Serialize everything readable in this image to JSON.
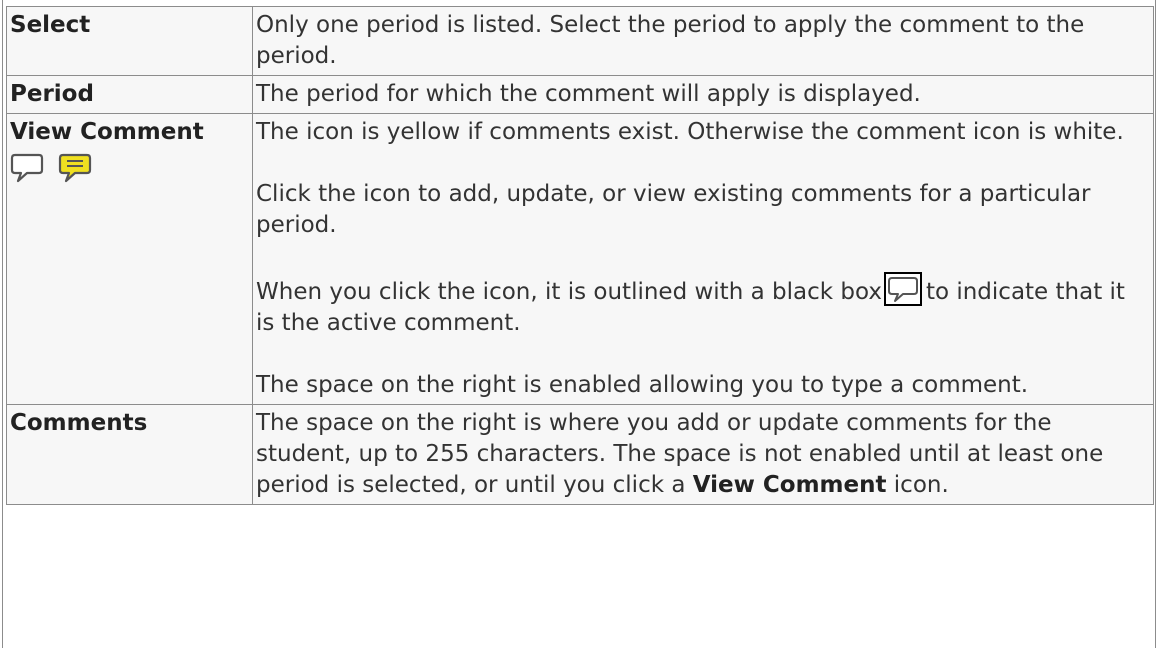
{
  "rows": [
    {
      "term": "Select",
      "desc": "Only one period is listed. Select the period to apply the comment to the period."
    },
    {
      "term": "Period",
      "desc": "The period for which the comment will apply is displayed."
    },
    {
      "term": "View Comment",
      "icons": [
        "comment-white-icon",
        "comment-yellow-icon"
      ],
      "p1": "The icon is yellow if comments exist. Otherwise the comment icon is white.",
      "p2": "Click the icon to add, update, or view existing comments for a particular period.",
      "p3_before": "When you click the icon, it is outlined with a black box",
      "p3_icon": "comment-outlined-icon",
      "p3_after": "to indicate that it is the active comment.",
      "p4": "The space on the right is enabled allowing you to type a comment."
    },
    {
      "term": "Comments",
      "desc_before": "The space on the right is where you add or update comments for the student, up to 255 characters. The space is not enabled until at least one period is selected, or until you click a",
      "desc_bold": "View Comment",
      "desc_after": "icon."
    }
  ],
  "colors": {
    "cell_background": "#f7f7f7",
    "border": "#8c8c8c",
    "text": "#333333",
    "comment_yellow": "#f0e020"
  }
}
